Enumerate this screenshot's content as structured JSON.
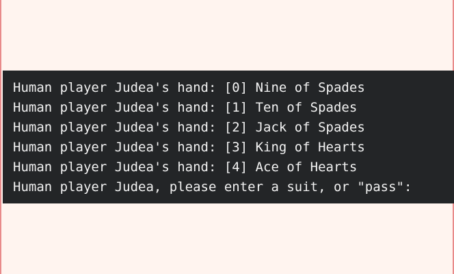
{
  "terminal": {
    "lines": [
      "Human player Judea's hand: [0] Nine of Spades",
      "Human player Judea's hand: [1] Ten of Spades",
      "Human player Judea's hand: [2] Jack of Spades",
      "Human player Judea's hand: [3] King of Hearts",
      "Human player Judea's hand: [4] Ace of Hearts",
      "Human player Judea, please enter a suit, or \"pass\":"
    ]
  },
  "colors": {
    "page_background": "#fff4ef",
    "terminal_background": "#232527",
    "terminal_text": "#f2f2f2",
    "border": "#e88a8a"
  }
}
